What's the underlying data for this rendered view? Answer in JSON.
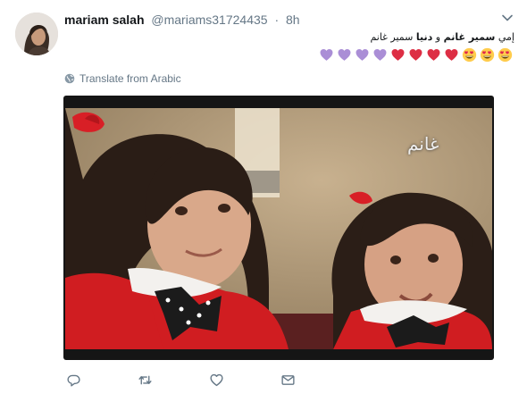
{
  "tweet": {
    "author_name": "mariam salah",
    "author_handle": "@mariams31724435",
    "separator": "·",
    "time": "8h",
    "text": {
      "part1": "إمي ",
      "bold1": "سمير غانم",
      "part2": " و ",
      "bold2": "دنيا",
      "part3": " سمير غانم"
    },
    "emojis": [
      "heart-eyes",
      "heart-eyes",
      "heart-eyes",
      "red-heart",
      "red-heart",
      "red-heart",
      "red-heart",
      "purple-heart",
      "purple-heart",
      "purple-heart",
      "purple-heart"
    ],
    "translate_label": "Translate from Arabic",
    "media_watermark": "غانم"
  },
  "colors": {
    "name": "#14171a",
    "secondary": "#657786",
    "red_heart": "#dd2e44",
    "purple_heart": "#aa8ed6",
    "emoji_face": "#ffcc4d"
  },
  "icons": {
    "chevron": "chevron-down-icon",
    "globe": "globe-icon",
    "reply": "reply-icon",
    "retweet": "retweet-icon",
    "like": "like-icon",
    "dm": "message-icon"
  }
}
